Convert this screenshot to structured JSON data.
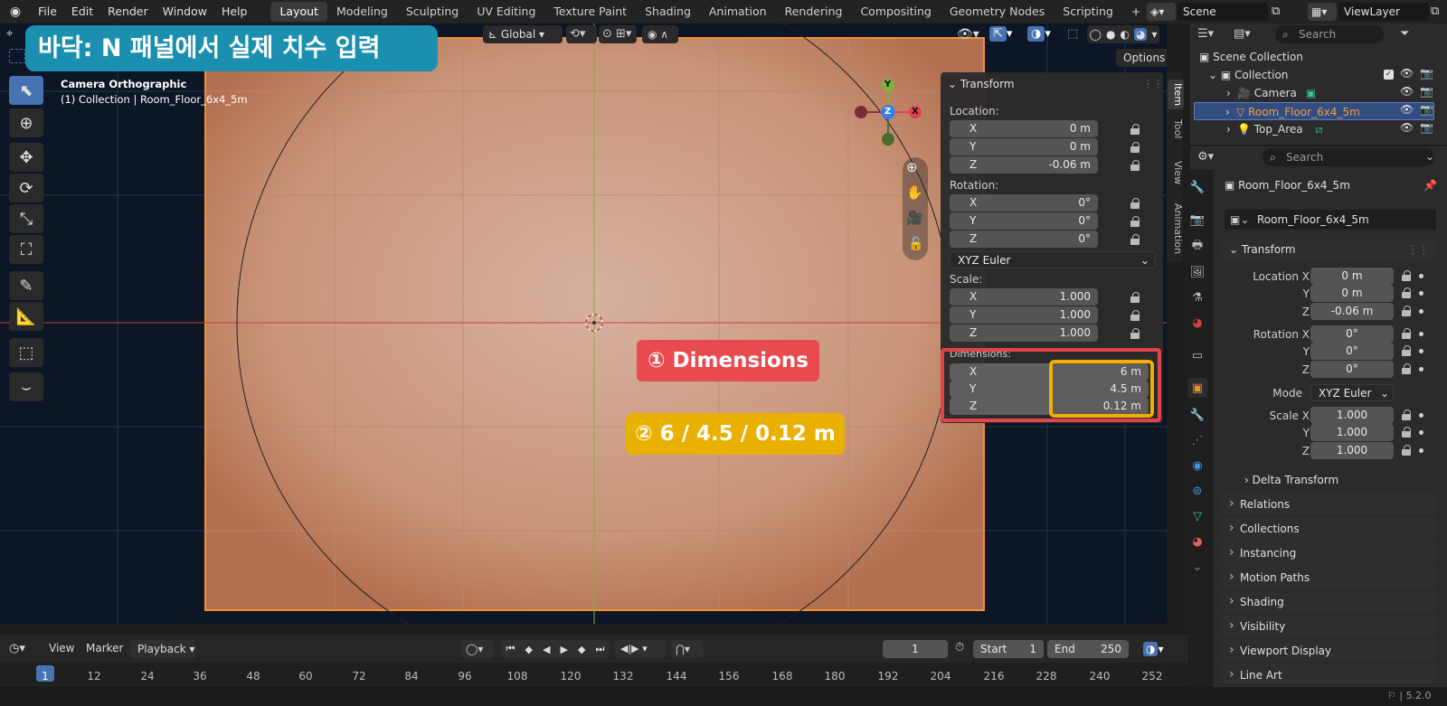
{
  "menu": [
    "File",
    "Edit",
    "Render",
    "Window",
    "Help"
  ],
  "workspaces": [
    "Layout",
    "Modeling",
    "Sculpting",
    "UV Editing",
    "Texture Paint",
    "Shading",
    "Animation",
    "Rendering",
    "Compositing",
    "Geometry Nodes",
    "Scripting"
  ],
  "active_workspace": "Layout",
  "add_workspace": "+",
  "scene": "Scene",
  "view_layer": "ViewLayer",
  "banner_title": "바닥: N 패널에서 실제 치수 입력",
  "viewport": {
    "orientation": "Global",
    "options_label": "Options",
    "camera_label": "Camera Orthographic",
    "collection_label": "(1) Collection | Room_Floor_6x4_5m",
    "gizmo": {
      "x": "X",
      "y": "Y",
      "z": "Z"
    }
  },
  "npanel": {
    "header": "Transform",
    "location_label": "Location:",
    "location": {
      "x": "0 m",
      "y": "0 m",
      "z": "-0.06 m"
    },
    "rotation_label": "Rotation:",
    "rotation": {
      "x": "0°",
      "y": "0°",
      "z": "0°"
    },
    "rotation_mode": "XYZ Euler",
    "scale_label": "Scale:",
    "scale": {
      "x": "1.000",
      "y": "1.000",
      "z": "1.000"
    },
    "dimensions_label": "Dimensions:",
    "dimensions": {
      "x": "6 m",
      "y": "4.5 m",
      "z": "0.12 m"
    },
    "axis": {
      "x": "X",
      "y": "Y",
      "z": "Z"
    },
    "tabs": [
      "Item",
      "Tool",
      "View",
      "Animation"
    ]
  },
  "callout1": "① Dimensions",
  "callout2": "② 6 / 4.5 / 0.12 m",
  "outliner": {
    "search_placeholder": "Search",
    "scene_collection": "Scene Collection",
    "collection": "Collection",
    "items": [
      "Camera",
      "Room_Floor_6x4_5m",
      "Top_Area"
    ]
  },
  "properties": {
    "search_placeholder": "Search",
    "object_name": "Room_Floor_6x4_5m",
    "datablock": "Room_Floor_6x4_5m",
    "transform_label": "Transform",
    "location_x_label": "Location X",
    "y_label": "Y",
    "z_label": "Z",
    "location": {
      "x": "0 m",
      "y": "0 m",
      "z": "-0.06 m"
    },
    "rotation_x_label": "Rotation X",
    "rotation": {
      "x": "0°",
      "y": "0°",
      "z": "0°"
    },
    "mode_label": "Mode",
    "mode_value": "XYZ Euler",
    "scale_x_label": "Scale X",
    "scale": {
      "x": "1.000",
      "y": "1.000",
      "z": "1.000"
    },
    "delta_transform": "Delta Transform",
    "sections": [
      "Relations",
      "Collections",
      "Instancing",
      "Motion Paths",
      "Shading",
      "Visibility",
      "Viewport Display",
      "Line Art"
    ]
  },
  "timeline": {
    "menu": [
      "View",
      "Marker",
      "Playback"
    ],
    "current_frame": "1",
    "start_label": "Start",
    "start": "1",
    "end_label": "End",
    "end": "250",
    "ticks": [
      "1",
      "12",
      "24",
      "36",
      "48",
      "60",
      "72",
      "84",
      "96",
      "108",
      "120",
      "132",
      "144",
      "156",
      "168",
      "180",
      "192",
      "204",
      "216",
      "228",
      "240",
      "252"
    ]
  },
  "version": "5.2.0"
}
